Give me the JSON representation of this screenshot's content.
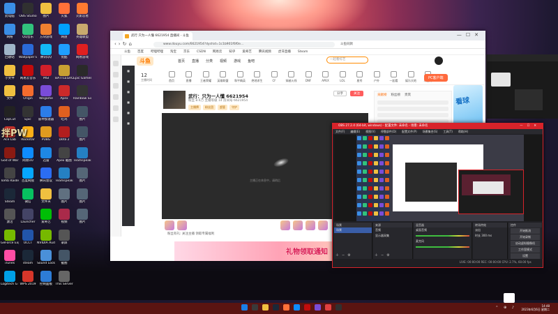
{
  "desktop": {
    "icons_col1": [
      {
        "label": "此电脑",
        "color": "#3a8ee6"
      },
      {
        "label": "网络",
        "color": "#3a8ee6"
      },
      {
        "label": "回收站",
        "color": "#9fb5c8"
      },
      {
        "label": "小文件",
        "color": "#f0c040"
      },
      {
        "label": "文件",
        "color": "#f0c040"
      },
      {
        "label": "CapCut",
        "color": "#222222"
      },
      {
        "label": "Ace Lab",
        "color": "#c0302a"
      },
      {
        "label": "God of War",
        "color": "#8a1a12"
      },
      {
        "label": "Tomb Raider",
        "color": "#444444"
      },
      {
        "label": "Steam",
        "color": "#1b2838"
      },
      {
        "label": "激活",
        "color": "#555555"
      },
      {
        "label": "GeForce Experience",
        "color": "#76b900"
      },
      {
        "label": "iTunes",
        "color": "#ff4da6"
      },
      {
        "label": "Logitech G HUB",
        "color": "#00a0e6"
      }
    ],
    "icons_col2": [
      {
        "label": "OBS Studio",
        "color": "#303030"
      },
      {
        "label": "QQ音乐",
        "color": "#31c27c"
      },
      {
        "label": "Wallpaper Engine",
        "color": "#2a6ad8"
      },
      {
        "label": "网易云音乐",
        "color": "#c20c0c"
      },
      {
        "label": "Origin",
        "color": "#f56c2d"
      },
      {
        "label": "Epic",
        "color": "#333333"
      },
      {
        "label": "Rockstar",
        "color": "#fcaf17"
      },
      {
        "label": "网易UU",
        "color": "#0e8cff"
      },
      {
        "label": "百度网盘",
        "color": "#06a7ff"
      },
      {
        "label": "微信",
        "color": "#07c160"
      },
      {
        "label": "Launcher",
        "color": "#444466"
      },
      {
        "label": "OCCT",
        "color": "#2255aa"
      },
      {
        "label": "steam",
        "color": "#1b2838"
      },
      {
        "label": "WPS 2019",
        "color": "#d6362a"
      }
    ],
    "icons_col3": [
      {
        "label": "图片",
        "color": "#f0c040"
      },
      {
        "label": "方块游戏",
        "color": "#f08030"
      },
      {
        "label": "腾讯QQ",
        "color": "#12b7f5"
      },
      {
        "label": "MSI",
        "color": "#d01f2a"
      },
      {
        "label": "Wegame",
        "color": "#7a4cd8"
      },
      {
        "label": "雷神加速器",
        "color": "#2b7de9"
      },
      {
        "label": "PUBG",
        "color": "#e09b1f"
      },
      {
        "label": "迅雷",
        "color": "#1e88e5"
      },
      {
        "label": "腾讯会议",
        "color": "#2b6df2"
      },
      {
        "label": "文件夹",
        "color": "#f0c040"
      },
      {
        "label": "爱奇艺",
        "color": "#00be06"
      },
      {
        "label": "NVIDIA Audio",
        "color": "#76b900"
      },
      {
        "label": "Sound Lock",
        "color": "#4a90d9"
      },
      {
        "label": "控制面板",
        "color": "#2d7cd6"
      }
    ],
    "icons_col4": [
      {
        "label": "火狐",
        "color": "#ff7139"
      },
      {
        "label": "网盘",
        "color": "#00a0ff"
      },
      {
        "label": "优酷",
        "color": "#1f9eff"
      },
      {
        "label": "BATTLEGROUNDS",
        "color": "#c8a032"
      },
      {
        "label": "Apex",
        "color": "#cc2a2a"
      },
      {
        "label": "吃鸡",
        "color": "#e06020"
      },
      {
        "label": "Dota 2",
        "color": "#b21e1e"
      },
      {
        "label": "Apex 截图",
        "color": "#444444"
      },
      {
        "label": "Teamspeak",
        "color": "#2580c3"
      },
      {
        "label": "图片",
        "color": "#607080"
      },
      {
        "label": "视频",
        "color": "#aa2a4a"
      },
      {
        "label": "录屏",
        "color": "#555555"
      },
      {
        "label": "截图",
        "color": "#445566"
      },
      {
        "label": "This Server",
        "color": "#666666"
      }
    ],
    "icons_col5": [
      {
        "label": "火影忍者",
        "color": "#ff7a30"
      },
      {
        "label": "英雄联盟",
        "color": "#c8aa6e"
      },
      {
        "label": "网易游戏",
        "color": "#e02020"
      },
      {
        "label": "Epic Games Launcher",
        "color": "#2a2a2a"
      },
      {
        "label": "Rainbow Six",
        "color": "#333333"
      },
      {
        "label": "图片",
        "color": "#445566"
      },
      {
        "label": "图片",
        "color": "#445566"
      },
      {
        "label": "Teamspeak",
        "color": "#2580c3"
      },
      {
        "label": "图片",
        "color": "#556677"
      },
      {
        "label": "图片",
        "color": "#556677"
      },
      {
        "label": "图片",
        "color": "#556677"
      }
    ],
    "overlay_text": "拌PW"
  },
  "browser": {
    "tab_title": "武行 只为一人懂 6621954 直播间 - 斗鱼",
    "url": "www.douyu.com/6621954?dyshid=1c1b901f6f0e...",
    "right_toolbar": "斗鱼同款",
    "bookmarks": [
      "斗鱼",
      "百度",
      "哔哩哔哩",
      "淘宝",
      "京东",
      "CSDN",
      "网易云",
      "知乎",
      "爱奇艺",
      "腾讯视频",
      "虎牙直播",
      "Steam"
    ],
    "logo": "斗鱼",
    "menu": [
      "首页",
      "直播",
      "分类",
      "视频",
      "游戏",
      "鱼吧"
    ],
    "search_placeholder": "一起看综艺",
    "followers_count": "12",
    "followers_label": "主播时间",
    "categories": [
      "首页",
      "直播",
      "王者荣耀",
      "英雄联盟",
      "和平精英",
      "绝地求生",
      "CF",
      "穿越火线",
      "DNF",
      "APEX",
      "LOL",
      "星秀",
      "户外",
      "一起看",
      "娱乐天地",
      "斗鱼传"
    ],
    "pc_client_label": "PC客户端",
    "room_title": "武行：只为一人懂",
    "room_id": "6621954",
    "room_subtitle": "粉丝 8.6万  主播等级 14  房间号 6621954",
    "room_tags": [
      "主播牌",
      "粉丝团",
      "超管",
      "守护"
    ],
    "share_label": "分享",
    "follow_label": "关注",
    "player_message": "主播正在休息中，请稍后",
    "hint_text": "粉丝有礼: 关注主播 领取专属福利",
    "rank_tabs": [
      "贡献榜",
      "粉丝榜",
      "贵宾"
    ],
    "ad_text": "礼物领取通知",
    "ad_go": "GO",
    "side_ad_text": "看球"
  },
  "obs": {
    "title": "OBS 27.2.4 (64-bit, windows) - 配置文件: 未命名 - 场景: 未命名",
    "menu": [
      "文件(F)",
      "编辑(E)",
      "视图(V)",
      "停靠部件(D)",
      "配置文件(P)",
      "场景集合(S)",
      "工具(T)",
      "帮助(H)"
    ],
    "docks": {
      "scenes": {
        "title": "场景",
        "items": [
          "场景"
        ]
      },
      "sources": {
        "title": "来源",
        "items": [
          "音频",
          "显示器采集"
        ]
      },
      "mixer": {
        "title": "混音器",
        "items": [
          "桌面音频",
          "麦克风"
        ]
      },
      "transitions": {
        "title": "转场特效",
        "items": [
          "淡出",
          "时长 300 ms"
        ]
      },
      "controls": {
        "title": "控件",
        "items": [
          "开始推流",
          "开始录制",
          "启动虚拟摄像机",
          "工作室模式",
          "设置",
          "退出"
        ]
      }
    },
    "status": "LIVE: 00:00:00  REC: 00:00:00  CPU: 2.7%, 60.00 fps"
  },
  "taskbar": {
    "time": "14:48",
    "date": "2023年6月6日 星期二",
    "icons": [
      "#1a7fe8",
      "#3a3a3a",
      "#f0c040",
      "#1b2838",
      "#ff7139",
      "#0e8cff",
      "#c20c0c",
      "#7a4cd8",
      "#e04040",
      "#303030"
    ]
  },
  "colors": {
    "accent": "#ff7a00",
    "obs_border": "#d8232a",
    "taskbar": "#5a1411"
  }
}
